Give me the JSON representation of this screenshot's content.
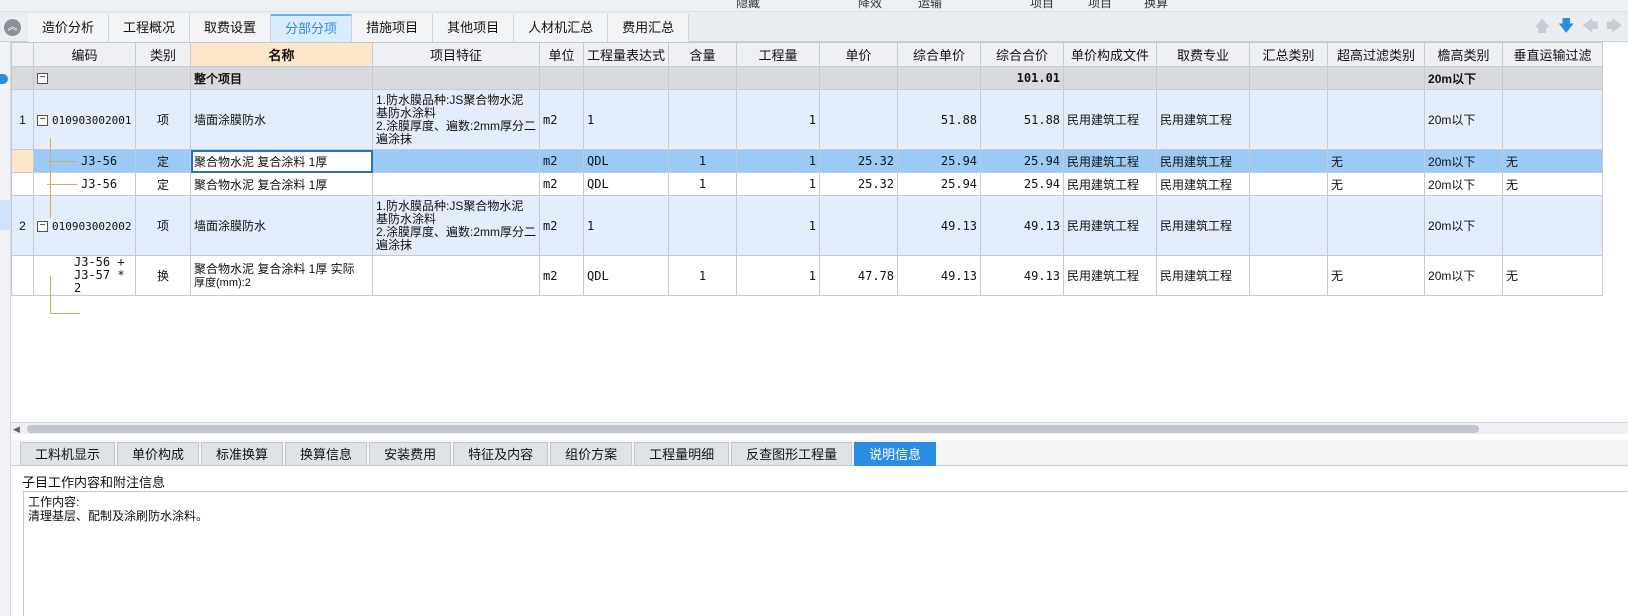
{
  "toolbar_top": [
    "隐藏",
    "降效",
    "运输",
    "项目",
    "项目",
    "换算"
  ],
  "tabs": [
    {
      "label": "造价分析",
      "active": false
    },
    {
      "label": "工程概况",
      "active": false
    },
    {
      "label": "取费设置",
      "active": false
    },
    {
      "label": "分部分项",
      "active": true
    },
    {
      "label": "措施项目",
      "active": false
    },
    {
      "label": "其他项目",
      "active": false
    },
    {
      "label": "人材机汇总",
      "active": false
    },
    {
      "label": "费用汇总",
      "active": false
    }
  ],
  "columns": [
    "编码",
    "类别",
    "名称",
    "项目特征",
    "单位",
    "工程量表达式",
    "含量",
    "工程量",
    "单价",
    "综合单价",
    "综合合价",
    "单价构成文件",
    "取费专业",
    "汇总类别",
    "超高过滤类别",
    "檐高类别",
    "垂直运输过滤"
  ],
  "rows": {
    "root": {
      "code": "",
      "type": "",
      "name": "整个项目",
      "feature": "",
      "unit": "",
      "expr": "",
      "content": "",
      "qty": "",
      "price": "",
      "unit_total": "",
      "total": "101.01",
      "price_file": "",
      "fee_major": "",
      "sum_type": "",
      "height_filter": "",
      "eave": "20m以下",
      "vertical": ""
    },
    "item1": {
      "seq": "1",
      "code": "010903002001",
      "type": "项",
      "name": "墙面涂膜防水",
      "feature_lines": [
        "1.防水膜品种:JS聚合物水泥",
        "基防水涂料",
        "2.涂膜厚度、遍数:2mm厚分二",
        "遍涂抹"
      ],
      "unit": "m2",
      "expr": "1",
      "content": "",
      "qty": "1",
      "price": "",
      "unit_total": "51.88",
      "total": "51.88",
      "price_file": "民用建筑工程",
      "fee_major": "民用建筑工程",
      "sum_type": "",
      "height_filter": "",
      "eave": "20m以下",
      "vertical": ""
    },
    "sub1": {
      "code": "J3-56",
      "type": "定",
      "name": "聚合物水泥 复合涂料 1厚",
      "feature": "",
      "unit": "m2",
      "expr": "QDL",
      "content": "1",
      "qty": "1",
      "price": "25.32",
      "unit_total": "25.94",
      "total": "25.94",
      "price_file": "民用建筑工程",
      "fee_major": "民用建筑工程",
      "sum_type": "",
      "height_filter": "无",
      "eave": "20m以下",
      "vertical": "无"
    },
    "sub2": {
      "code": "J3-56",
      "type": "定",
      "name": "聚合物水泥 复合涂料 1厚",
      "feature": "",
      "unit": "m2",
      "expr": "QDL",
      "content": "1",
      "qty": "1",
      "price": "25.32",
      "unit_total": "25.94",
      "total": "25.94",
      "price_file": "民用建筑工程",
      "fee_major": "民用建筑工程",
      "sum_type": "",
      "height_filter": "无",
      "eave": "20m以下",
      "vertical": "无"
    },
    "item2": {
      "seq": "2",
      "code": "010903002002",
      "type": "项",
      "name": "墙面涂膜防水",
      "feature_lines": [
        "1.防水膜品种:JS聚合物水泥",
        "基防水涂料",
        "2.涂膜厚度、遍数:2mm厚分二",
        "遍涂抹"
      ],
      "unit": "m2",
      "expr": "1",
      "content": "",
      "qty": "1",
      "price": "",
      "unit_total": "49.13",
      "total": "49.13",
      "price_file": "民用建筑工程",
      "fee_major": "民用建筑工程",
      "sum_type": "",
      "height_filter": "",
      "eave": "20m以下",
      "vertical": ""
    },
    "sub3": {
      "code_lines": [
        "J3-56 +",
        "J3-57 * 2"
      ],
      "type": "换",
      "name_lines": [
        "聚合物水泥 复合涂料 1厚  实际",
        "厚度(mm):2"
      ],
      "feature": "",
      "unit": "m2",
      "expr": "QDL",
      "content": "1",
      "qty": "1",
      "price": "47.78",
      "unit_total": "49.13",
      "total": "49.13",
      "price_file": "民用建筑工程",
      "fee_major": "民用建筑工程",
      "sum_type": "",
      "height_filter": "无",
      "eave": "20m以下",
      "vertical": "无"
    }
  },
  "bottom_tabs": [
    {
      "label": "工料机显示",
      "active": false
    },
    {
      "label": "单价构成",
      "active": false
    },
    {
      "label": "标准换算",
      "active": false
    },
    {
      "label": "换算信息",
      "active": false
    },
    {
      "label": "安装费用",
      "active": false
    },
    {
      "label": "特征及内容",
      "active": false
    },
    {
      "label": "组价方案",
      "active": false
    },
    {
      "label": "工程量明细",
      "active": false
    },
    {
      "label": "反查图形工程量",
      "active": false
    },
    {
      "label": "说明信息",
      "active": true
    }
  ],
  "description": {
    "title": "子目工作内容和附注信息",
    "line1": "工作内容:",
    "line2": "清理基层、配制及涂刷防水涂料。"
  },
  "icons": {
    "collapse": "collapse-up-icon",
    "nav": [
      "arrow-up-icon",
      "arrow-down-icon",
      "arrow-left-icon",
      "arrow-right-icon"
    ]
  },
  "colors": {
    "accent": "#2a8de0",
    "selected_row": "#9ccaf6",
    "item_row": "#e3edfb",
    "header_name": "#fde7c8"
  }
}
